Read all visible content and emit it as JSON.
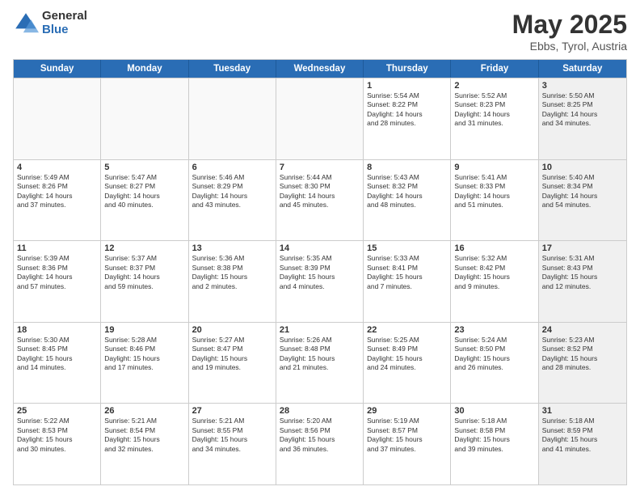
{
  "logo": {
    "general": "General",
    "blue": "Blue"
  },
  "title": {
    "month": "May 2025",
    "location": "Ebbs, Tyrol, Austria"
  },
  "header": {
    "days": [
      "Sunday",
      "Monday",
      "Tuesday",
      "Wednesday",
      "Thursday",
      "Friday",
      "Saturday"
    ]
  },
  "weeks": [
    [
      {
        "day": "",
        "text": "",
        "empty": true
      },
      {
        "day": "",
        "text": "",
        "empty": true
      },
      {
        "day": "",
        "text": "",
        "empty": true
      },
      {
        "day": "",
        "text": "",
        "empty": true
      },
      {
        "day": "1",
        "text": "Sunrise: 5:54 AM\nSunset: 8:22 PM\nDaylight: 14 hours\nand 28 minutes."
      },
      {
        "day": "2",
        "text": "Sunrise: 5:52 AM\nSunset: 8:23 PM\nDaylight: 14 hours\nand 31 minutes."
      },
      {
        "day": "3",
        "text": "Sunrise: 5:50 AM\nSunset: 8:25 PM\nDaylight: 14 hours\nand 34 minutes.",
        "shaded": true
      }
    ],
    [
      {
        "day": "4",
        "text": "Sunrise: 5:49 AM\nSunset: 8:26 PM\nDaylight: 14 hours\nand 37 minutes."
      },
      {
        "day": "5",
        "text": "Sunrise: 5:47 AM\nSunset: 8:27 PM\nDaylight: 14 hours\nand 40 minutes."
      },
      {
        "day": "6",
        "text": "Sunrise: 5:46 AM\nSunset: 8:29 PM\nDaylight: 14 hours\nand 43 minutes."
      },
      {
        "day": "7",
        "text": "Sunrise: 5:44 AM\nSunset: 8:30 PM\nDaylight: 14 hours\nand 45 minutes."
      },
      {
        "day": "8",
        "text": "Sunrise: 5:43 AM\nSunset: 8:32 PM\nDaylight: 14 hours\nand 48 minutes."
      },
      {
        "day": "9",
        "text": "Sunrise: 5:41 AM\nSunset: 8:33 PM\nDaylight: 14 hours\nand 51 minutes."
      },
      {
        "day": "10",
        "text": "Sunrise: 5:40 AM\nSunset: 8:34 PM\nDaylight: 14 hours\nand 54 minutes.",
        "shaded": true
      }
    ],
    [
      {
        "day": "11",
        "text": "Sunrise: 5:39 AM\nSunset: 8:36 PM\nDaylight: 14 hours\nand 57 minutes."
      },
      {
        "day": "12",
        "text": "Sunrise: 5:37 AM\nSunset: 8:37 PM\nDaylight: 14 hours\nand 59 minutes."
      },
      {
        "day": "13",
        "text": "Sunrise: 5:36 AM\nSunset: 8:38 PM\nDaylight: 15 hours\nand 2 minutes."
      },
      {
        "day": "14",
        "text": "Sunrise: 5:35 AM\nSunset: 8:39 PM\nDaylight: 15 hours\nand 4 minutes."
      },
      {
        "day": "15",
        "text": "Sunrise: 5:33 AM\nSunset: 8:41 PM\nDaylight: 15 hours\nand 7 minutes."
      },
      {
        "day": "16",
        "text": "Sunrise: 5:32 AM\nSunset: 8:42 PM\nDaylight: 15 hours\nand 9 minutes."
      },
      {
        "day": "17",
        "text": "Sunrise: 5:31 AM\nSunset: 8:43 PM\nDaylight: 15 hours\nand 12 minutes.",
        "shaded": true
      }
    ],
    [
      {
        "day": "18",
        "text": "Sunrise: 5:30 AM\nSunset: 8:45 PM\nDaylight: 15 hours\nand 14 minutes."
      },
      {
        "day": "19",
        "text": "Sunrise: 5:28 AM\nSunset: 8:46 PM\nDaylight: 15 hours\nand 17 minutes."
      },
      {
        "day": "20",
        "text": "Sunrise: 5:27 AM\nSunset: 8:47 PM\nDaylight: 15 hours\nand 19 minutes."
      },
      {
        "day": "21",
        "text": "Sunrise: 5:26 AM\nSunset: 8:48 PM\nDaylight: 15 hours\nand 21 minutes."
      },
      {
        "day": "22",
        "text": "Sunrise: 5:25 AM\nSunset: 8:49 PM\nDaylight: 15 hours\nand 24 minutes."
      },
      {
        "day": "23",
        "text": "Sunrise: 5:24 AM\nSunset: 8:50 PM\nDaylight: 15 hours\nand 26 minutes."
      },
      {
        "day": "24",
        "text": "Sunrise: 5:23 AM\nSunset: 8:52 PM\nDaylight: 15 hours\nand 28 minutes.",
        "shaded": true
      }
    ],
    [
      {
        "day": "25",
        "text": "Sunrise: 5:22 AM\nSunset: 8:53 PM\nDaylight: 15 hours\nand 30 minutes."
      },
      {
        "day": "26",
        "text": "Sunrise: 5:21 AM\nSunset: 8:54 PM\nDaylight: 15 hours\nand 32 minutes."
      },
      {
        "day": "27",
        "text": "Sunrise: 5:21 AM\nSunset: 8:55 PM\nDaylight: 15 hours\nand 34 minutes."
      },
      {
        "day": "28",
        "text": "Sunrise: 5:20 AM\nSunset: 8:56 PM\nDaylight: 15 hours\nand 36 minutes."
      },
      {
        "day": "29",
        "text": "Sunrise: 5:19 AM\nSunset: 8:57 PM\nDaylight: 15 hours\nand 37 minutes."
      },
      {
        "day": "30",
        "text": "Sunrise: 5:18 AM\nSunset: 8:58 PM\nDaylight: 15 hours\nand 39 minutes."
      },
      {
        "day": "31",
        "text": "Sunrise: 5:18 AM\nSunset: 8:59 PM\nDaylight: 15 hours\nand 41 minutes.",
        "shaded": true
      }
    ]
  ]
}
